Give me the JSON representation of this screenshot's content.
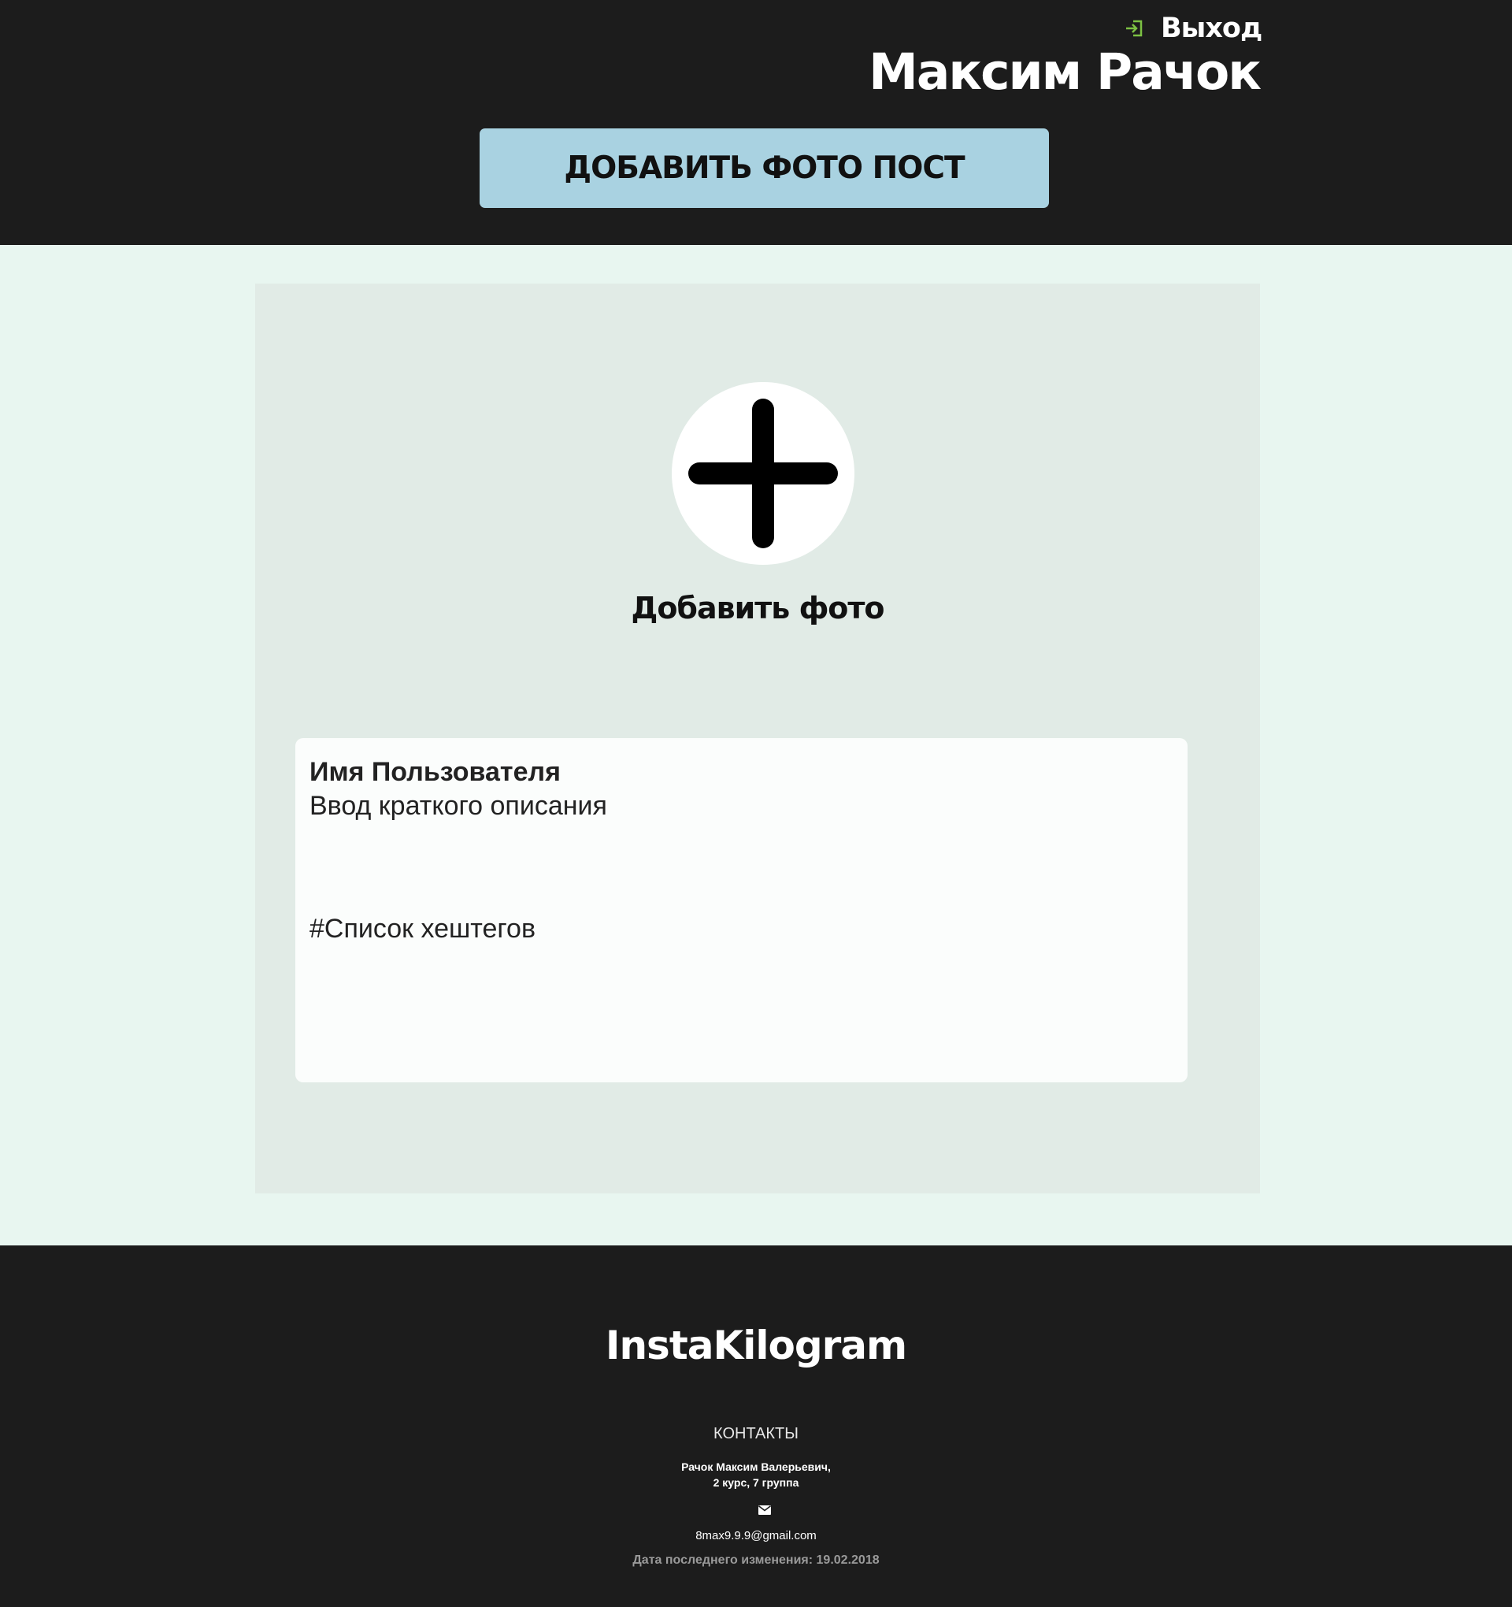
{
  "header": {
    "logout_label": "Выход",
    "user_name": "Максим Рачок",
    "add_post_label": "ДОБАВИТЬ ФОТО ПОСТ"
  },
  "upload": {
    "add_photo_label": "Добавить фото"
  },
  "post_card": {
    "username": "Имя Пользователя",
    "description": "Ввод краткого описания",
    "hashtags": "#Список хештегов"
  },
  "footer": {
    "brand": "InstaKilogram",
    "contacts_title": "КОНТАКТЫ",
    "contact_name_line1": "Рачок Максим Валерьевич,",
    "contact_name_line2": "2 курс, 7 группа",
    "email": "8max9.9.9@gmail.com",
    "last_modified": "Дата последнего изменения: 19.02.2018"
  },
  "colors": {
    "header_bg": "#1c1c1c",
    "page_bg": "#e8f6f0",
    "panel_bg": "#e1ebe6",
    "button_bg": "#a9d2e1",
    "logout_icon": "#7cc143"
  },
  "icons": {
    "logout": "logout-icon",
    "add_photo": "plus-icon",
    "email": "mail-icon"
  }
}
